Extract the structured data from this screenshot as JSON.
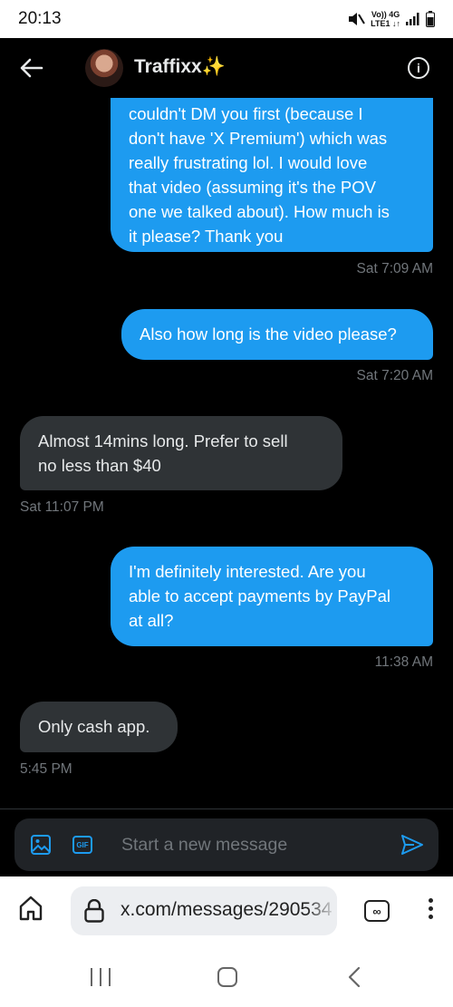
{
  "status_bar": {
    "time": "20:13",
    "network_top": "Vo)) 4G",
    "network_bottom": "LTE1 ↓↑"
  },
  "header": {
    "contact_name": "Traffixx✨",
    "back_icon": "arrow-left-icon",
    "info_icon": "info-icon"
  },
  "messages": [
    {
      "direction": "sent",
      "text": "couldn't DM you first (because I don't have 'X Premium') which was really frustrating lol. I would love that video (assuming it's the POV one we talked about). How much is it please? Thank you",
      "lines": [
        "couldn't DM you first (because I",
        "don't have 'X Premium') which was",
        "really frustrating lol. I would love",
        "that video (assuming it's the POV",
        "one we talked about). How much is",
        "it please? Thank you"
      ],
      "timestamp": "Sat 7:09 AM"
    },
    {
      "direction": "sent",
      "text": "Also how long is the video please?",
      "timestamp": "Sat 7:20 AM"
    },
    {
      "direction": "received",
      "text": "Almost 14mins long. Prefer to sell no less than $40",
      "lines": [
        "Almost 14mins long. Prefer to sell",
        "no less than $40"
      ],
      "timestamp": "Sat 11:07 PM"
    },
    {
      "direction": "sent",
      "text": "I'm definitely interested. Are you able to accept payments by PayPal at all?",
      "lines": [
        "I'm definitely interested. Are you",
        "able to accept payments by PayPal",
        "at all?"
      ],
      "timestamp": "11:38 AM"
    },
    {
      "direction": "received",
      "text": "Only cash app.",
      "timestamp": "5:45 PM"
    }
  ],
  "composer": {
    "placeholder": "Start a new message",
    "gif_label": "GIF",
    "media_icon": "image-icon",
    "send_icon": "send-icon"
  },
  "browser": {
    "url": "x.com/messages/290534",
    "tabs_label": "∞"
  },
  "colors": {
    "accent": "#1d9bf0",
    "received_bubble": "#2f3336",
    "muted": "#71767b"
  }
}
